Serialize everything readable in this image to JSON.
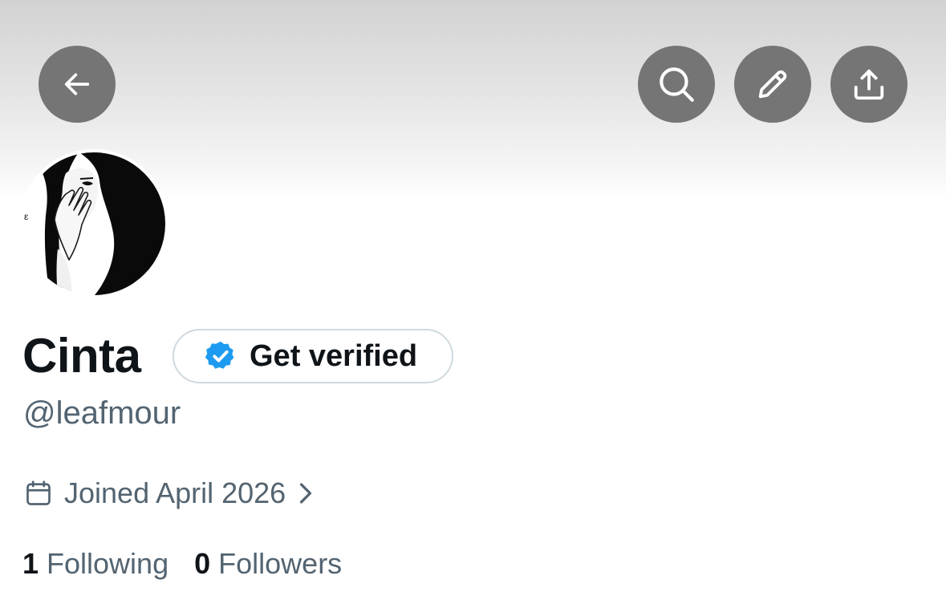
{
  "profile": {
    "name": "Cinta",
    "handle": "@leafmour",
    "get_verified_label": "Get verified",
    "joined": "Joined April 2026",
    "stats": [
      {
        "count": "1",
        "label": "Following"
      },
      {
        "count": "0",
        "label": "Followers"
      }
    ]
  },
  "icons": {
    "back": "arrow-left-icon",
    "search": "search-icon",
    "edit": "pencil-icon",
    "share": "share-upload-icon",
    "verified": "verified-badge-icon",
    "calendar": "calendar-icon",
    "chevron": "chevron-right-icon"
  },
  "colors": {
    "header_button_bg": "#757575",
    "verified_blue": "#1d9bf0",
    "text_primary": "#0f1419",
    "text_secondary": "#536471",
    "pill_border": "#cfd9de"
  }
}
